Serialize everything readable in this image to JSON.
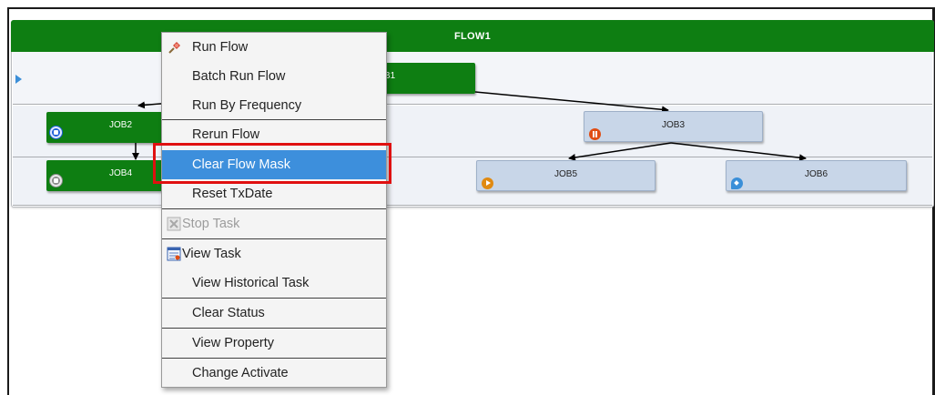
{
  "flow": {
    "title": "FLOW1"
  },
  "jobs": [
    {
      "id": "job1",
      "label": "JOB1",
      "label_visible": "B1",
      "status": "running",
      "color": "#0e7e12"
    },
    {
      "id": "job2",
      "label": "JOB2",
      "status": "stopped-blue",
      "color": "#0e7e12"
    },
    {
      "id": "job3",
      "label": "JOB3",
      "status": "paused",
      "color": "#c8d6e8"
    },
    {
      "id": "job4",
      "label": "JOB4",
      "status": "stopped-gray",
      "color": "#0e7e12"
    },
    {
      "id": "job5",
      "label": "JOB5",
      "status": "play",
      "color": "#c8d6e8"
    },
    {
      "id": "job6",
      "label": "JOB6",
      "status": "tag",
      "color": "#c8d6e8"
    }
  ],
  "context_menu": {
    "items": [
      {
        "label": "Run Flow",
        "icon": "pin-icon",
        "disabled": false,
        "highlight": false
      },
      {
        "label": "Batch Run Flow",
        "icon": "",
        "disabled": false,
        "highlight": false
      },
      {
        "label": "Run By Frequency",
        "icon": "",
        "disabled": false,
        "highlight": false
      },
      {
        "label": "Rerun Flow",
        "icon": "",
        "disabled": false,
        "highlight": false
      },
      {
        "label": "Clear Flow Mask",
        "icon": "",
        "disabled": false,
        "highlight": true
      },
      {
        "label": "Reset TxDate",
        "icon": "",
        "disabled": false,
        "highlight": false
      },
      {
        "label": "Stop Task",
        "icon": "stop-icon",
        "disabled": true,
        "highlight": false
      },
      {
        "label": "View Task",
        "icon": "task-icon",
        "disabled": false,
        "highlight": false
      },
      {
        "label": "View Historical Task",
        "icon": "",
        "disabled": false,
        "highlight": false
      },
      {
        "label": "Clear Status",
        "icon": "",
        "disabled": false,
        "highlight": false
      },
      {
        "label": "View Property",
        "icon": "",
        "disabled": false,
        "highlight": false
      },
      {
        "label": "Change Activate",
        "icon": "",
        "disabled": false,
        "highlight": false
      }
    ]
  },
  "colors": {
    "header_green": "#0e7e12",
    "highlight_blue": "#3d8fdc",
    "annotation_red": "#e01010"
  }
}
